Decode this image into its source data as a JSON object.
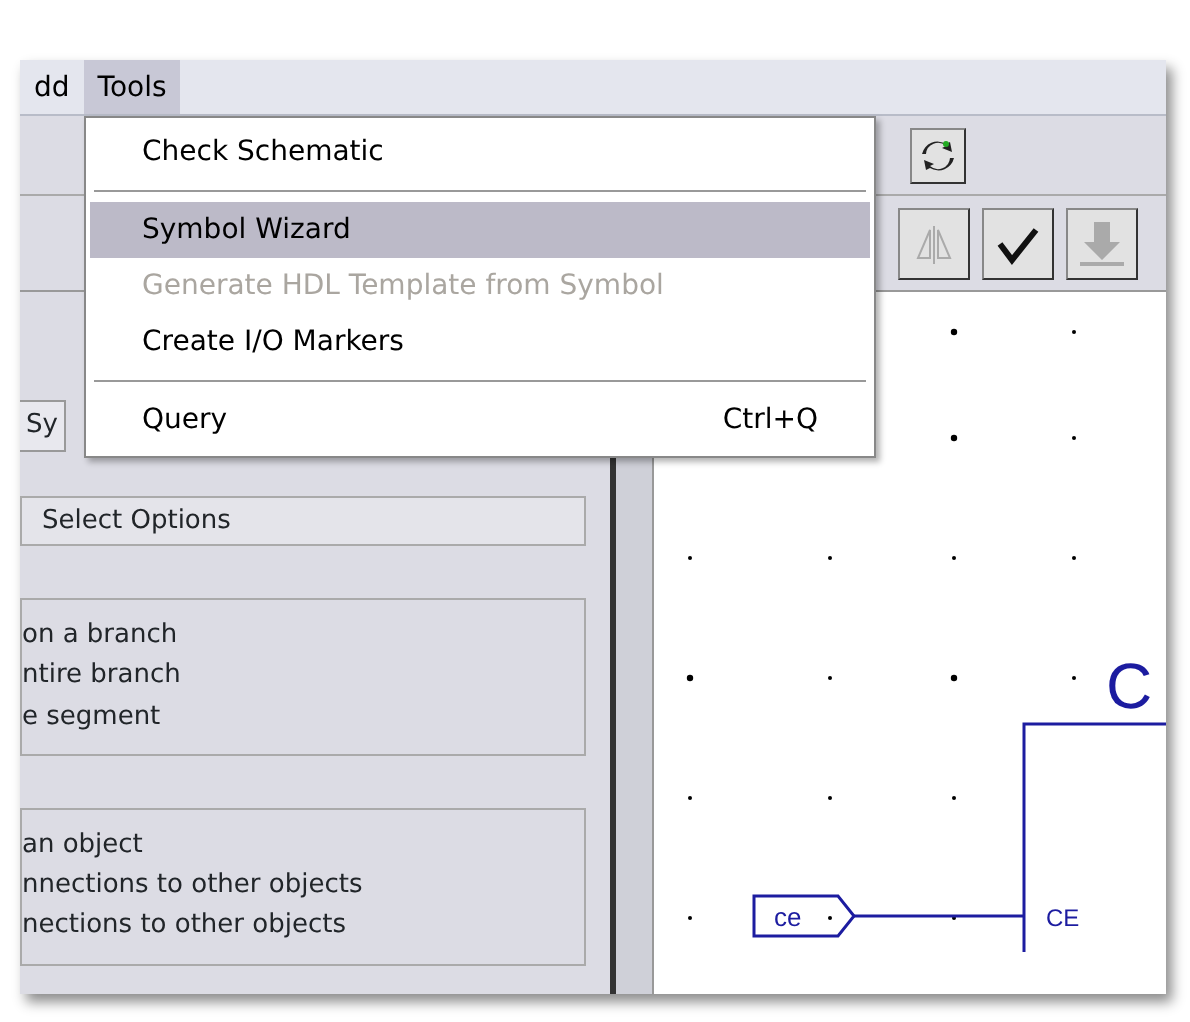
{
  "menubar": [
    {
      "label": "dd",
      "selected": false
    },
    {
      "label": "Tools",
      "selected": true
    }
  ],
  "tools_menu": [
    {
      "kind": "item",
      "label": "Check Schematic",
      "disabled": false,
      "selected": false
    },
    {
      "kind": "separator"
    },
    {
      "kind": "item",
      "label": "Symbol Wizard",
      "disabled": false,
      "selected": true
    },
    {
      "kind": "item",
      "label": "Generate HDL Template from Symbol",
      "disabled": true,
      "selected": false
    },
    {
      "kind": "item",
      "label": "Create I/O Markers",
      "disabled": false,
      "selected": false
    },
    {
      "kind": "separator"
    },
    {
      "kind": "item",
      "label": "Query",
      "shortcut": "Ctrl+Q",
      "disabled": false,
      "selected": false
    }
  ],
  "toolbar": [
    {
      "kind": "mirror",
      "disabled": true
    },
    {
      "kind": "check",
      "disabled": false
    },
    {
      "kind": "download",
      "disabled": true
    }
  ],
  "left_panel": {
    "tab_label": "Sy",
    "header": "Select Options",
    "groups": [
      {
        "lines": [
          "on a branch",
          "ntire branch",
          "e segment"
        ]
      },
      {
        "lines": [
          "an object",
          "nnections to other objects",
          "nections to other objects"
        ]
      }
    ]
  },
  "canvas": {
    "symbol_title": "C",
    "io_marker": "ce",
    "pin_label": "CE"
  }
}
